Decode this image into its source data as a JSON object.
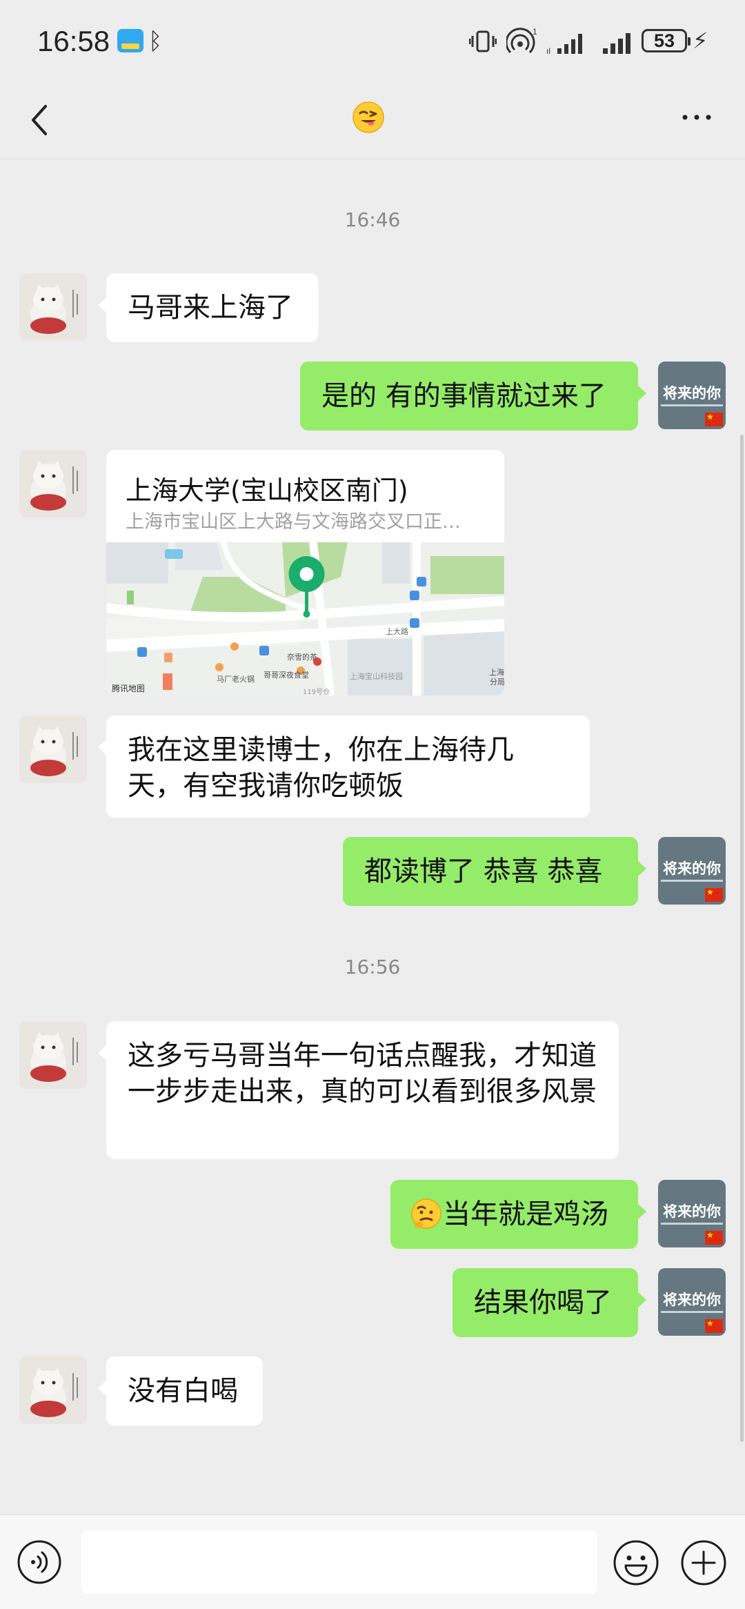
{
  "status_bar": {
    "time": "16:58",
    "battery": "53",
    "icons": [
      "app-badge-icon",
      "bluetooth-icon",
      "vibrate-icon",
      "hotspot-icon",
      "signal-icon",
      "signal-icon",
      "battery-icon",
      "charging-icon"
    ]
  },
  "header": {
    "title_icon": "squinting-tongue-emoji-icon",
    "back_icon": "chevron-left-icon",
    "more_icon": "more-dots-icon"
  },
  "messages": {
    "ts1": "16:46",
    "m1": "马哥来上海了",
    "m2": "是的 有的事情就过来了",
    "location": {
      "title": "上海大学(宝山校区南门)",
      "address": "上海市宝山区上大路与文海路交叉口正…",
      "map_labels": {
        "road": "上大路",
        "brand": "腾讯地图",
        "poi1": "马厂老火锅",
        "poi2": "哥哥深夜食堂",
        "poi3": "奈雪的茶",
        "poi4": "上海宝山科技园",
        "poi5": "上海",
        "poi6": "分局",
        "poi7": "119号仓"
      }
    },
    "m3": "我在这里读博士，你在上海待几天，有空我请你吃顿饭",
    "m4": "都读博了  恭喜 恭喜",
    "ts2": "16:56",
    "m5": "这多亏马哥当年一句话点醒我，才知道一步步走出来，真的可以看到很多风景",
    "m6": "当年就是鸡汤",
    "m7": "结果你喝了",
    "m8": "没有白喝"
  },
  "avatar_me": {
    "text": "将来的你"
  },
  "input_bar": {
    "value": "",
    "placeholder": "",
    "voice_icon": "voice-icon",
    "emoji_icon": "emoji-icon",
    "plus_icon": "plus-icon"
  },
  "colors": {
    "background": "#ededed",
    "outgoing_bubble": "#95ec69",
    "incoming_bubble": "#ffffff",
    "map_pin": "#1aad6b"
  }
}
